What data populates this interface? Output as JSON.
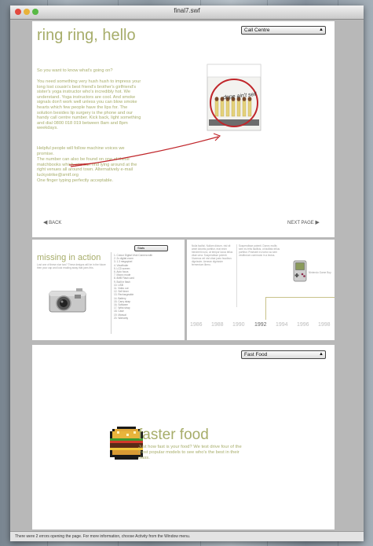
{
  "window": {
    "title": "final7.swf"
  },
  "top_panel": {
    "dropdown_value": "Call Centre",
    "heading": "ring ring, hello",
    "intro": "So you want to know what's going on?",
    "paragraph1": "You need something very hush hush to impress your long lost cousin's best friend's brother's girlfriend's sister's yoga instructor who's incredibly hot. We understand. Yoga instructors are cool. And smoke signals don't work well unless you can blow smoke hearts which few people have the lips for. The solution besides lip surgery is the phone and our handy call centre number. Kick back, light something and dial 0800 018 019 between 8am and 8pm weekdays.",
    "paragraph2": "Helpful people will follow machine voices we promise.",
    "paragraph3": "The number can also be found on one of these matchbooks which you can find lying around at the right venues all around town. Alternatively e-mail luckystrike@smtf.org",
    "paragraph4": "One finger typing perfectly acceptable.",
    "back_label": "BACK",
    "next_label": "NEXT PAGE",
    "matchbox_text": "dope ain't sell"
  },
  "mid_left_panel": {
    "dropdown_value": "Stats",
    "heading": "missing in action",
    "caption": "Lost one of these nice two? These designs will be in the future then your cap and look reading away that joins this.",
    "list": [
      "1. Colour Digital Vivid Camera with",
      "2. 2x digital zoom",
      "3. 1.3 megapixel",
      "4. Viewfinder",
      "5. LCD screen",
      "6. Auto focus",
      "7. Macro mode",
      "8. 8MB Flash card",
      "9. Built in flash",
      "10. USB",
      "11. Video out",
      "12. Self timer",
      "13. Rechargeable",
      "14. Battery",
      "15. Carry strap",
      "16. Software",
      "17. Wrist strap",
      "18. Case",
      "19. Manual",
      "20. Warranty"
    ]
  },
  "mid_right_panel": {
    "col1": "Nulla facilisi. Nullam dictum, nisl sit amet lobortis porttitor, erat enim hendrerit nunc, at tempor lacus tellus vitae urna. Suspendisse potenti. Vivamus vel nisi vitae justo faucibus dignissim. Aenean dignissim fermentum libero.",
    "col2": "Suspendisse potenti. Donec mollis sem eu felis facilisis, ut facilisis tellus porttitor. Praesent eu tortor ac sem vestibulum commodo in a lectus.",
    "device_caption": "Nintendo Game Boy",
    "timeline_years": [
      "1986",
      "1988",
      "1990",
      "1992",
      "1994",
      "1996",
      "1998"
    ],
    "timeline_active": "1992"
  },
  "bottom_panel": {
    "dropdown_value": "Fast Food",
    "heading": "faster food",
    "body": "Just how fast is your food? We test drive four of the most popular models to see who's the best in their class."
  },
  "status_bar": {
    "text": "There were 2 errors opening the page. For more information, choose Activity from the Window menu."
  },
  "colors": {
    "accent_text": "#a7ad6a",
    "annotation_red": "#c0262b",
    "panel_bg": "#ffffff",
    "window_bg": "#b8b8b8"
  }
}
